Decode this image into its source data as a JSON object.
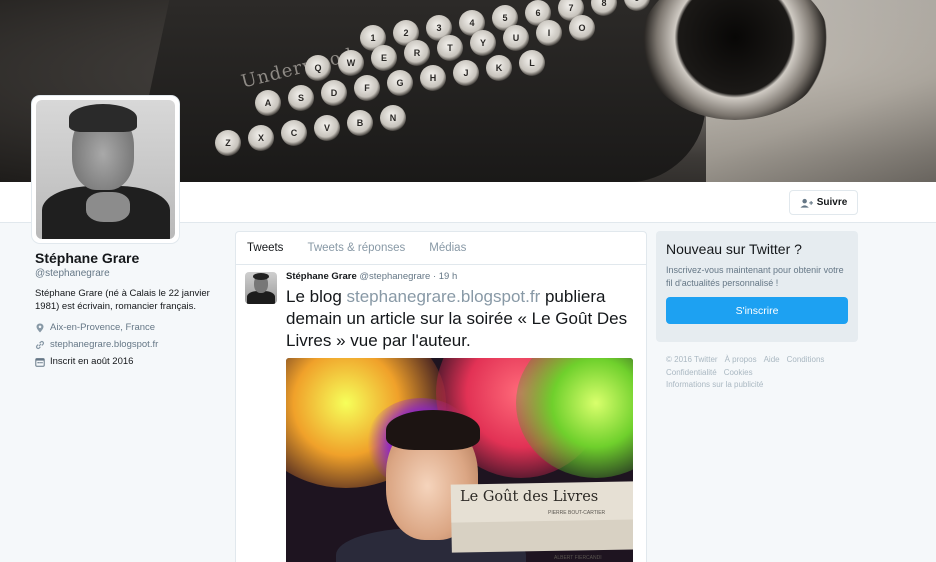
{
  "banner": {
    "brand_text": "Underwood",
    "keys": [
      "1",
      "2",
      "3",
      "4",
      "5",
      "6",
      "7",
      "8",
      "9",
      "Q",
      "W",
      "E",
      "R",
      "T",
      "Y",
      "U",
      "I",
      "O",
      "A",
      "S",
      "D",
      "F",
      "G",
      "H",
      "J",
      "K",
      "L",
      "Z",
      "X",
      "C",
      "V",
      "B",
      "N"
    ]
  },
  "profile": {
    "name": "Stéphane Grare",
    "handle": "@stephanegrare",
    "bio": "Stéphane Grare (né à Calais le 22 janvier 1981) est écrivain, romancier français.",
    "location": "Aix-en-Provence, France",
    "website": "stephanegrare.blogspot.fr",
    "joined": "Inscrit en août 2016"
  },
  "actions": {
    "follow_label": "Suivre"
  },
  "tabs": [
    {
      "label": "Tweets",
      "active": true
    },
    {
      "label": "Tweets & réponses",
      "active": false
    },
    {
      "label": "Médias",
      "active": false
    }
  ],
  "tweet": {
    "author_name": "Stéphane Grare",
    "author_handle": "@stephanegrare",
    "separator": "·",
    "time": "19 h",
    "text_before": "Le blog ",
    "link": "stephanegrare.blogspot.fr",
    "text_after": " publiera demain un article sur la soirée « Le Goût Des Livres » vue par l'auteur.",
    "media": {
      "book_title": "Le Goût des Livres",
      "book_subtitle": "PIERRE BOUT-CARTIER",
      "book_subtitle2": "ALBERT FIERCANDI"
    }
  },
  "signup": {
    "title": "Nouveau sur Twitter ?",
    "description": "Inscrivez-vous maintenant pour obtenir votre fil d'actualités personnalisé !",
    "button_label": "S'inscrire"
  },
  "footer": {
    "links": [
      "© 2016 Twitter",
      "À propos",
      "Aide",
      "Conditions",
      "Confidentialité",
      "Cookies",
      "Informations sur la publicité"
    ]
  },
  "colors": {
    "accent": "#1da1f2",
    "background": "#f5f8fa",
    "muted_text": "#657786"
  },
  "icons": {
    "follow": "add-user-icon",
    "location": "location-pin-icon",
    "website": "link-icon",
    "joined": "calendar-icon"
  }
}
